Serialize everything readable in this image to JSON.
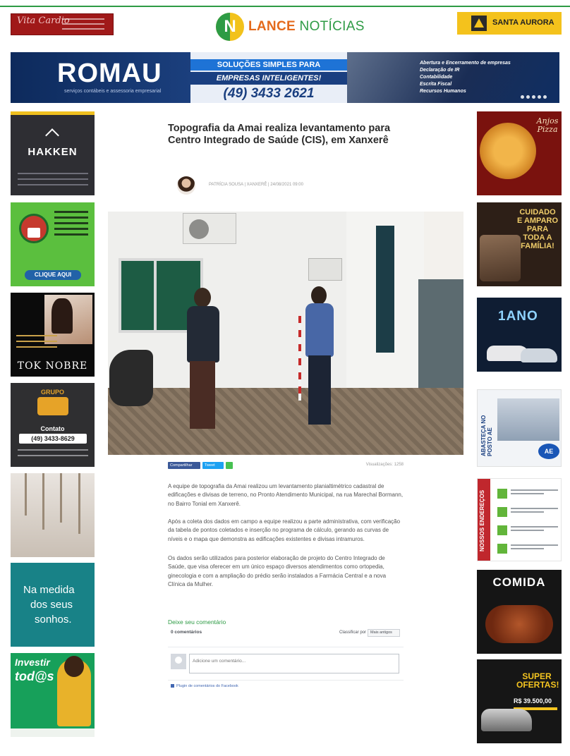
{
  "header": {
    "logo_text_1": "LANCE",
    "logo_text_2": "NOTÍCIAS",
    "logo_letter": "N",
    "ad_left_brand": "Vita Cardio",
    "ad_right_brand": "SANTA AURORA"
  },
  "banner": {
    "brand": "ROMAU",
    "brand_sub": "serviços contábeis e assessoria empresarial",
    "headline_1": "SOLUÇÕES SIMPLES PARA",
    "headline_2": "EMPRESAS INTELIGENTES!",
    "phone": "(49) 3433 2621",
    "services": [
      "Abertura e Encerramento de empresas",
      "Declaração de IR",
      "Contabilidade",
      "Escrita Fiscal",
      "Recursos Humanos"
    ]
  },
  "left_ads": {
    "hakken": "HAKKEN",
    "green_button": "CLIQUE AQUI",
    "tok_brand": "TOK NOBRE",
    "m1_group": "GRUPO",
    "m1_contact": "Contato",
    "m1_phone": "(49) 3433-8629",
    "teal_line1": "Na medida",
    "teal_line2": "dos seus",
    "teal_line3": "sonhos.",
    "investir_1": "Investir",
    "investir_2": "tod@s"
  },
  "right_ads": {
    "pizza_brand": "Anjos Pizza",
    "familia": "CUIDADO E AMPARO PARA TODA A FAMÍLIA!",
    "car_ano": "1ANO",
    "posto_text": "ABASTEÇA NO POSTO AE",
    "posto_badge": "AE",
    "enderecos_title": "NOSSOS ENDEREÇOS",
    "comida": "COMIDA",
    "oferta_1": "SUPER",
    "oferta_2": "OFERTAS!",
    "oferta_price": "R$ 39.500,00"
  },
  "article": {
    "title": "Topografia da Amai realiza levantamento para Centro Integrado de Saúde (CIS), em Xanxerê",
    "author_line": "PATRÍCIA SOUSA | XANXERÊ | 24/08/2021 09:00",
    "share_fb": "Compartilhar",
    "share_tw": "Tweet",
    "views": "Visualizações: 1258",
    "paragraphs": [
      "A equipe de topografia da Amai realizou um levantamento planialtimétrico cadastral de edificações e divisas de terreno, no Pronto Atendimento Municipal, na rua Marechal Bormann, no Bairro Tonial em Xanxerê.",
      "Após a coleta dos dados em campo a equipe realizou a parte administrativa, com verificação da tabela de pontos coletados e inserção no programa de cálculo, gerando as curvas de níveis e o mapa que demonstra as edificações existentes e divisas intramuros.",
      "Os dados serão utilizados para posterior elaboração de projeto do Centro Integrado de Saúde, que visa oferecer em um único espaço diversos atendimentos como ortopedia, ginecologia e com a ampliação do prédio serão instalados a Farmácia Central e a nova Clínica da Mulher."
    ]
  },
  "comments": {
    "title": "Deixe seu comentário",
    "count": "0 comentários",
    "sort_label": "Classificar por",
    "sort_value": "Mais antigos",
    "placeholder": "Adicione um comentário...",
    "plugin": "Plugin de comentários do Facebook"
  },
  "colors": {
    "brand_green": "#2e9b45",
    "brand_orange": "#e46a1c",
    "facebook_blue": "#3b5998"
  }
}
